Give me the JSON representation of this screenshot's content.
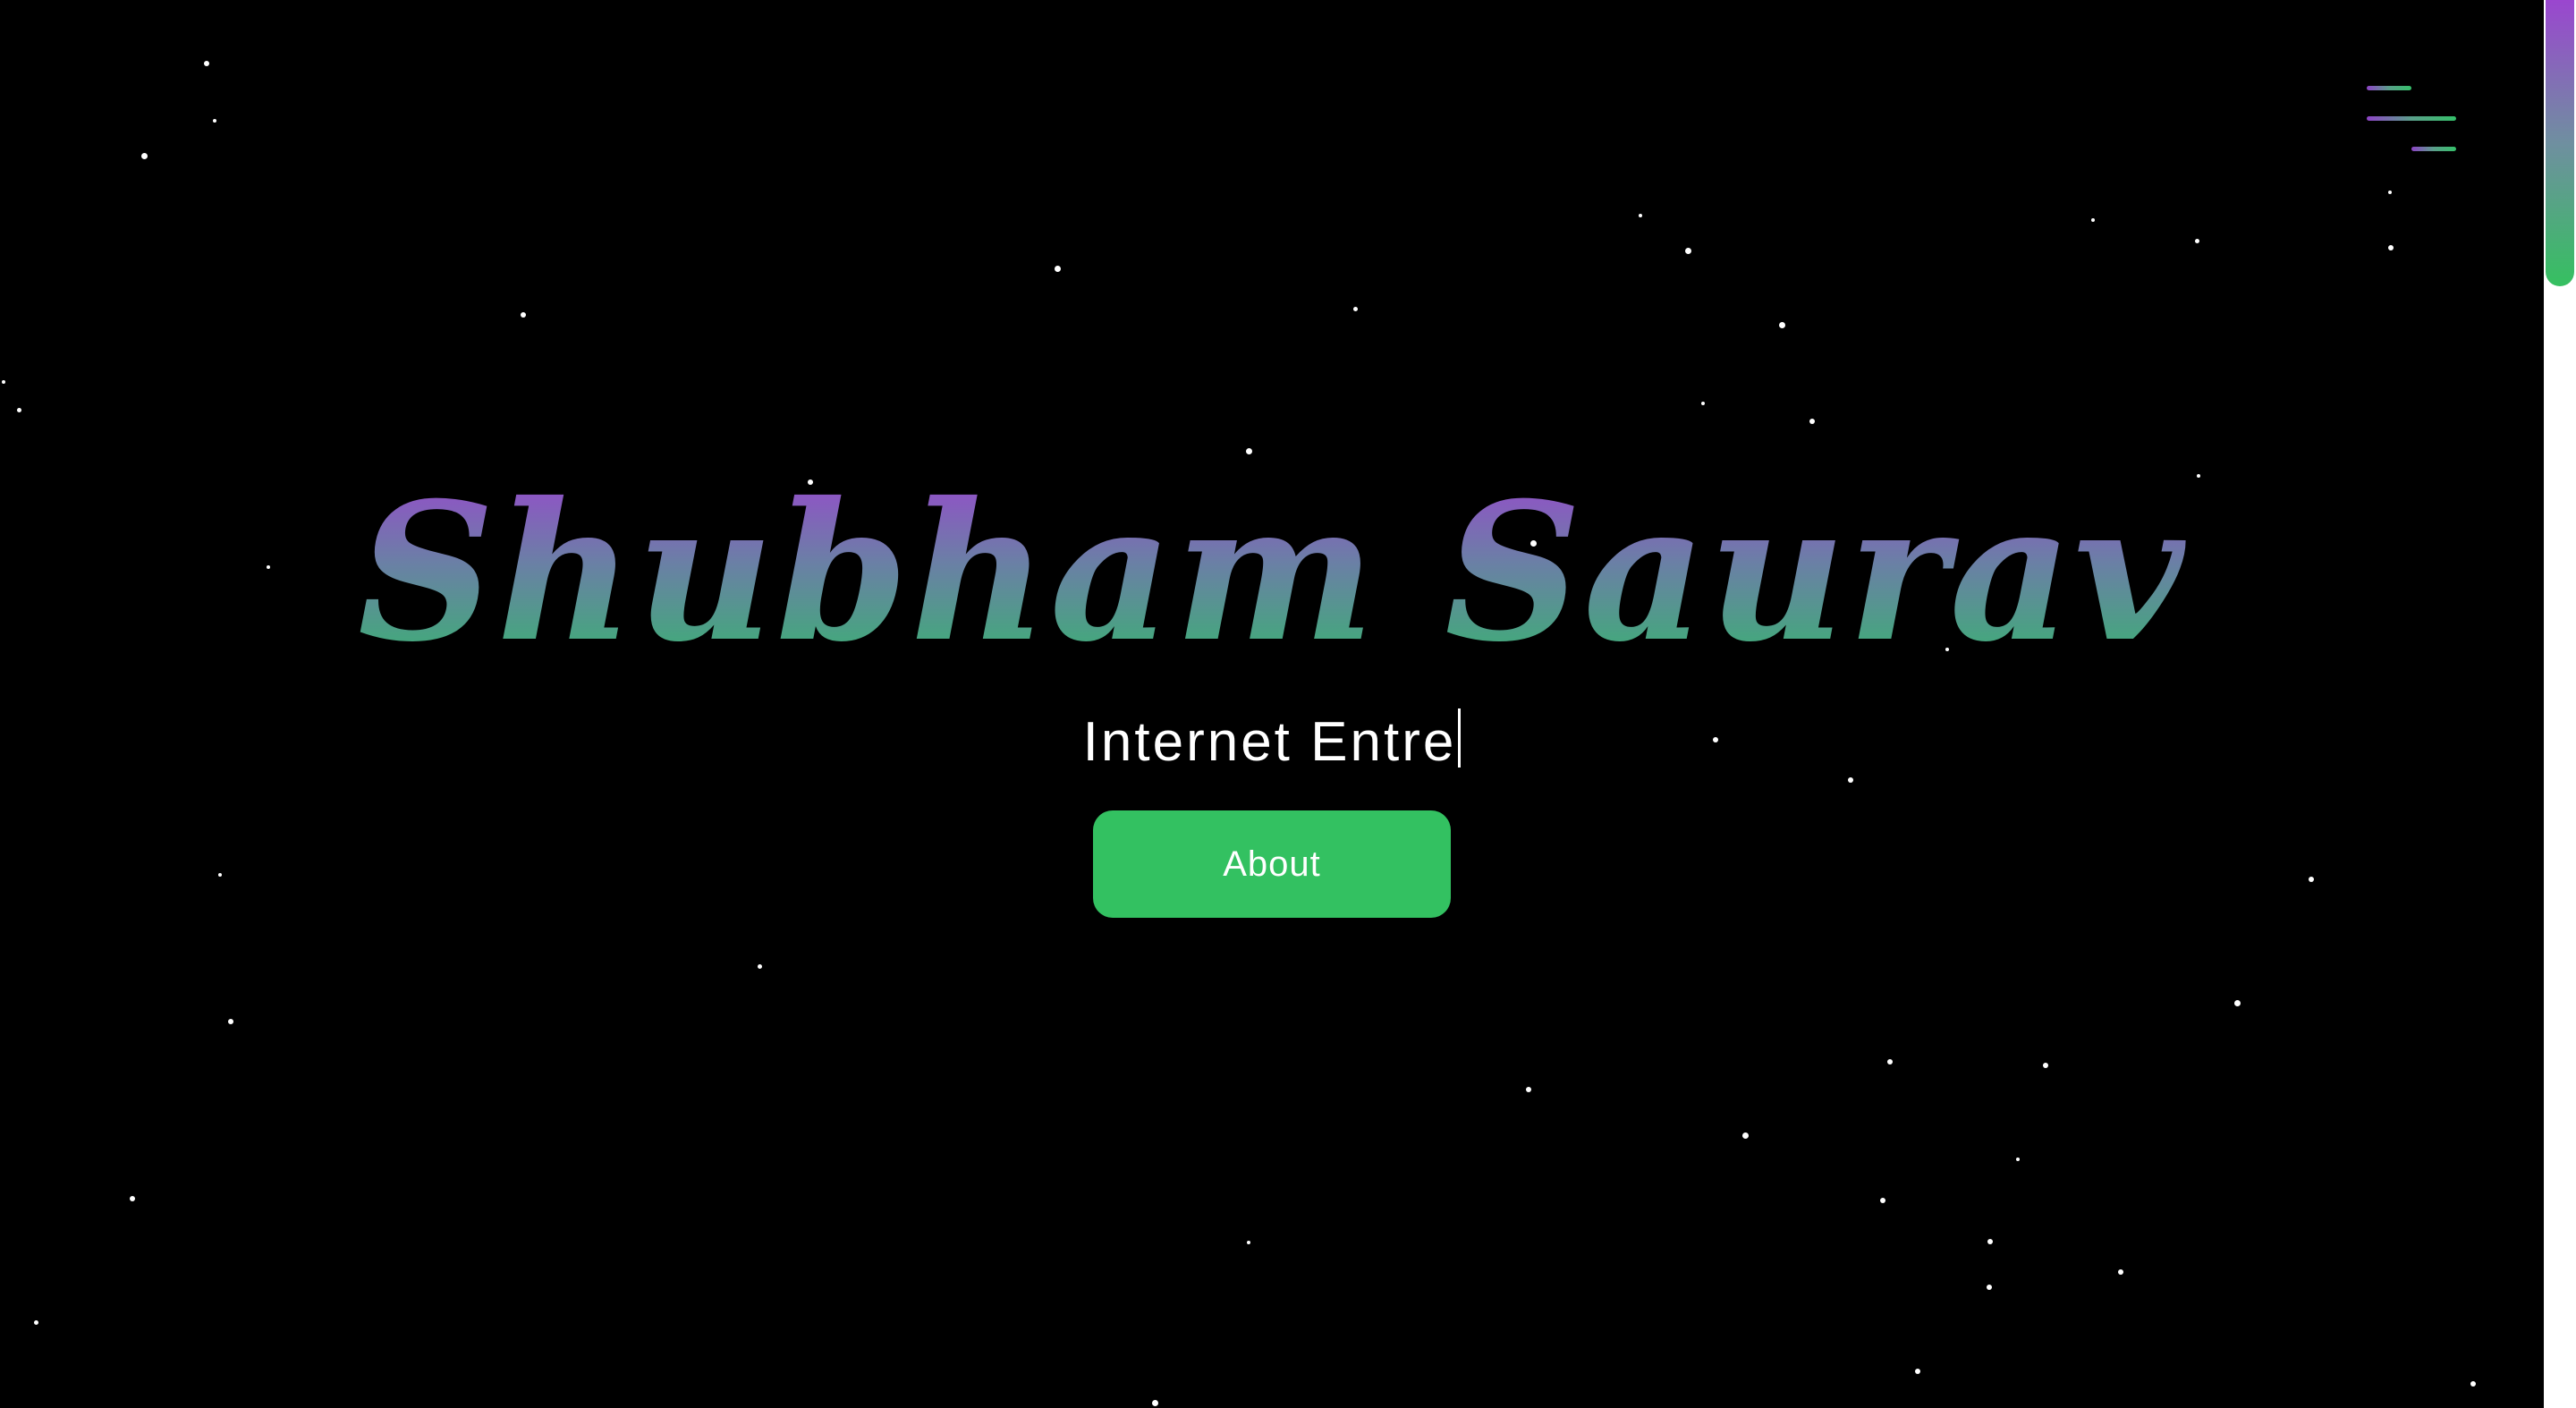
{
  "hero": {
    "name": "Shubham Saurav",
    "typed_subtitle": "Internet Entre"
  },
  "menu": {
    "icon": "hamburger-menu-icon"
  },
  "about_button": {
    "label": "About"
  },
  "colors": {
    "background": "#000000",
    "accent_green": "#33c161",
    "gradient_purple": "#9a46cf",
    "gradient_green": "#34b86c",
    "star": "#ffffff"
  },
  "scrollbar": {
    "scroll_fraction": 0.0
  }
}
